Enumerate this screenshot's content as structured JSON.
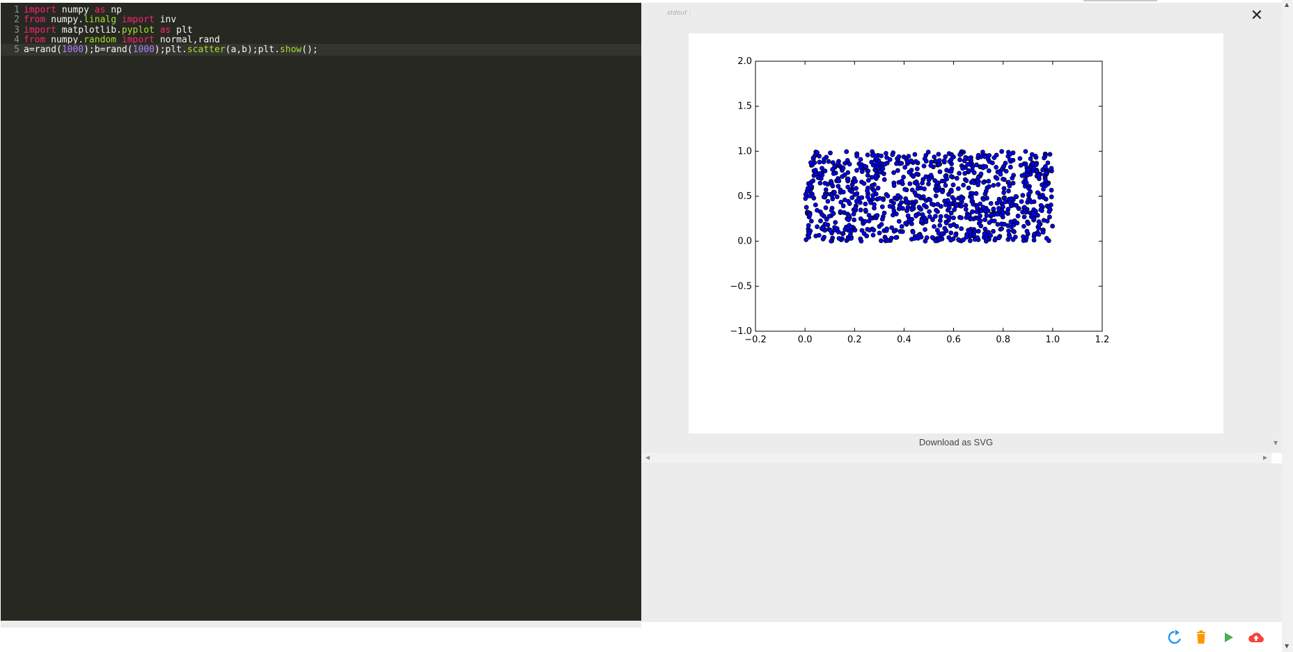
{
  "editor": {
    "lines": [
      {
        "num": "1",
        "parts": [
          {
            "t": "import",
            "c": "kw"
          },
          {
            "t": " numpy "
          },
          {
            "t": "as",
            "c": "kw"
          },
          {
            "t": " np"
          }
        ]
      },
      {
        "num": "2",
        "parts": [
          {
            "t": "from",
            "c": "kw"
          },
          {
            "t": " numpy."
          },
          {
            "t": "linalg",
            "c": "fn"
          },
          {
            "t": " "
          },
          {
            "t": "import",
            "c": "kw"
          },
          {
            "t": " inv"
          }
        ]
      },
      {
        "num": "3",
        "parts": [
          {
            "t": "import",
            "c": "kw"
          },
          {
            "t": " matplotlib."
          },
          {
            "t": "pyplot",
            "c": "fn"
          },
          {
            "t": " "
          },
          {
            "t": "as",
            "c": "kw"
          },
          {
            "t": " plt"
          }
        ]
      },
      {
        "num": "4",
        "parts": [
          {
            "t": "from",
            "c": "kw"
          },
          {
            "t": " numpy."
          },
          {
            "t": "random",
            "c": "fn"
          },
          {
            "t": " "
          },
          {
            "t": "import",
            "c": "kw"
          },
          {
            "t": " normal,rand"
          }
        ]
      },
      {
        "num": "5",
        "active": true,
        "parts": [
          {
            "t": "a=rand("
          },
          {
            "t": "1000",
            "c": "num"
          },
          {
            "t": ");b=rand("
          },
          {
            "t": "1000",
            "c": "num"
          },
          {
            "t": ");plt."
          },
          {
            "t": "scatter",
            "c": "fn"
          },
          {
            "t": "(a,b);plt."
          },
          {
            "t": "show",
            "c": "fn"
          },
          {
            "t": "();"
          }
        ]
      }
    ]
  },
  "output": {
    "stdout_label": "stdout :",
    "close_symbol": "✕",
    "download_label": "Download as SVG"
  },
  "toolbar": {
    "buttons": [
      {
        "name": "refresh-button",
        "icon": "refresh-icon",
        "color": "#2196f3"
      },
      {
        "name": "delete-button",
        "icon": "trash-icon",
        "color": "#ff9800"
      },
      {
        "name": "run-button",
        "icon": "play-icon",
        "color": "#4caf50"
      },
      {
        "name": "upload-button",
        "icon": "cloud-upload-icon",
        "color": "#f44336"
      }
    ]
  },
  "chart_data": {
    "type": "scatter",
    "title": "",
    "xlabel": "",
    "ylabel": "",
    "xlim": [
      -0.2,
      1.2
    ],
    "ylim": [
      -1.0,
      2.0
    ],
    "xticks": [
      "−0.2",
      "0.0",
      "0.2",
      "0.4",
      "0.6",
      "0.8",
      "1.0",
      "1.2"
    ],
    "yticks": [
      "2.0",
      "1.5",
      "1.0",
      "0.5",
      "0.0",
      "−0.5",
      "−1.0"
    ],
    "grid": false,
    "marker_color": "#0000ff",
    "n_points": 1000,
    "distribution": "uniform",
    "series": [
      {
        "x": [
          0.04,
          0.12,
          0.27,
          0.33,
          0.45,
          0.51,
          0.58,
          0.66,
          0.74,
          0.81,
          0.89,
          0.97,
          0.02,
          0.19,
          0.23,
          0.38,
          0.47,
          0.55,
          0.62,
          0.71,
          0.78,
          0.86,
          0.93,
          0.08,
          0.15,
          0.3,
          0.41,
          0.49,
          0.57,
          0.69,
          0.76,
          0.84,
          0.91,
          0.99,
          0.06,
          0.17,
          0.26,
          0.35,
          0.43,
          0.53,
          0.64,
          0.73,
          0.82,
          0.95
        ],
        "y": [
          0.95,
          0.82,
          0.71,
          0.93,
          0.66,
          0.88,
          0.52,
          0.77,
          0.91,
          0.44,
          0.69,
          0.97,
          0.31,
          0.58,
          0.12,
          0.36,
          0.21,
          0.05,
          0.41,
          0.17,
          0.63,
          0.28,
          0.08,
          0.49,
          0.03,
          0.84,
          0.57,
          0.38,
          0.73,
          0.26,
          0.11,
          0.9,
          0.55,
          0.35,
          0.72,
          0.25,
          0.46,
          0.15,
          0.79,
          0.62,
          0.99,
          0.33,
          0.02,
          0.19
        ]
      }
    ]
  }
}
